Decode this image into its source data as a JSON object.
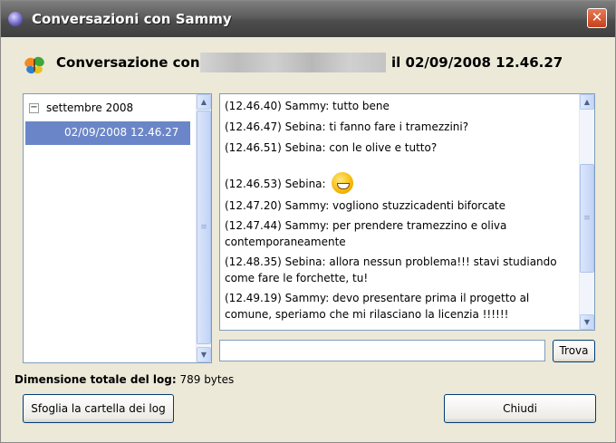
{
  "window": {
    "title": "Conversazioni con Sammy"
  },
  "header": {
    "label": "Conversazione con",
    "date": "il 02/09/2008 12.46.27"
  },
  "tree": {
    "group": "settembre 2008",
    "group_expander": "−",
    "selected_item": "02/09/2008 12.46.27"
  },
  "messages": [
    {
      "text": "(12.46.40) Sammy: tutto bene"
    },
    {
      "text": "(12.46.47) Sebina: ti fanno fare i tramezzini?"
    },
    {
      "text": "(12.46.51) Sebina: con le olive e tutto?"
    },
    {
      "text": "(12.46.53) Sebina:",
      "emoticon": "grin-smiley-icon"
    },
    {
      "text": "(12.47.20) Sammy: vogliono stuzzicadenti  biforcate"
    },
    {
      "text": "(12.47.44) Sammy: per prendere tramezzino e oliva contemporaneamente"
    },
    {
      "text": "(12.48.35) Sebina: allora nessun problema!!! stavi studiando come fare le forchette, tu!"
    },
    {
      "text": "(12.49.19) Sammy: devo presentare prima il progetto al comune, speriamo che mi rilasciano la licenzia !!!!!!"
    }
  ],
  "search": {
    "value": "",
    "button": "Trova"
  },
  "footer": {
    "log_size_label": "Dimensione totale del log:",
    "log_size_value": "789 bytes",
    "browse_button": "Sfoglia la cartella dei log",
    "close_button": "Chiudi"
  },
  "icons": {
    "close": "close-icon",
    "app": "messenger-app-icon",
    "logo": "msn-butterfly-icon"
  },
  "colors": {
    "selection": "#6b86c8",
    "titlebar": "#5c5c5c",
    "close_button": "#d9542b",
    "panel_border": "#7f9db9"
  }
}
